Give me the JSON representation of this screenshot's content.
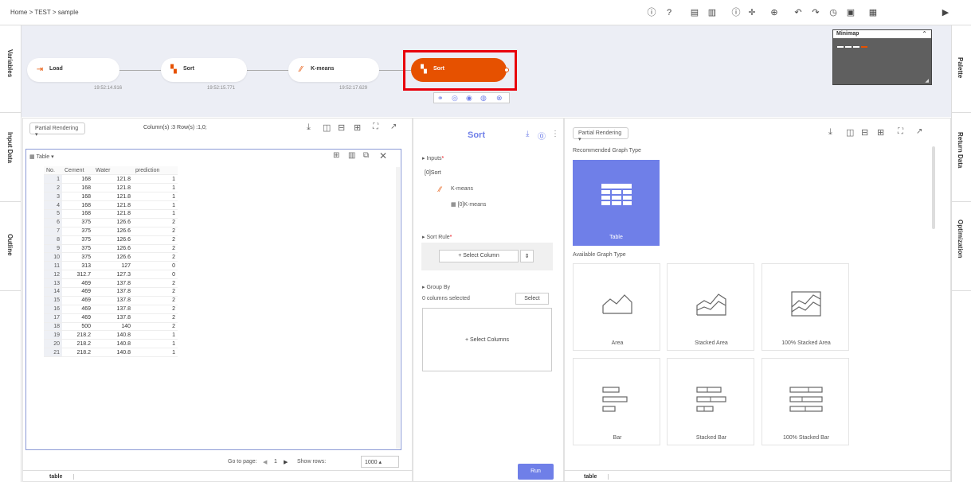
{
  "breadcrumb": "Home > TEST > sample",
  "rails": {
    "left": [
      "Variables",
      "Input Data",
      "Outline"
    ],
    "right": [
      "Palette",
      "Return Data",
      "Optimization"
    ]
  },
  "nodes": [
    {
      "label": "Load",
      "time": "19:52:14.916"
    },
    {
      "label": "Sort",
      "time": "19:52:15.771"
    },
    {
      "label": "K-means",
      "time": "19:52:17.629"
    },
    {
      "label": "Sort",
      "time": ""
    }
  ],
  "minimap": {
    "title": "Minimap"
  },
  "left_panel": {
    "render_mode": "Partial Rendering",
    "stats": "Column(s) :3   Row(s) :1,0;",
    "view_label": "Table",
    "columns": [
      "No.",
      "Cement",
      "Water",
      "prediction"
    ],
    "rows": [
      [
        "1",
        "168",
        "121.8",
        "1"
      ],
      [
        "2",
        "168",
        "121.8",
        "1"
      ],
      [
        "3",
        "168",
        "121.8",
        "1"
      ],
      [
        "4",
        "168",
        "121.8",
        "1"
      ],
      [
        "5",
        "168",
        "121.8",
        "1"
      ],
      [
        "6",
        "375",
        "126.6",
        "2"
      ],
      [
        "7",
        "375",
        "126.6",
        "2"
      ],
      [
        "8",
        "375",
        "126.6",
        "2"
      ],
      [
        "9",
        "375",
        "126.6",
        "2"
      ],
      [
        "10",
        "375",
        "126.6",
        "2"
      ],
      [
        "11",
        "313",
        "127",
        "0"
      ],
      [
        "12",
        "312.7",
        "127.3",
        "0"
      ],
      [
        "13",
        "469",
        "137.8",
        "2"
      ],
      [
        "14",
        "469",
        "137.8",
        "2"
      ],
      [
        "15",
        "469",
        "137.8",
        "2"
      ],
      [
        "16",
        "469",
        "137.8",
        "2"
      ],
      [
        "17",
        "469",
        "137.8",
        "2"
      ],
      [
        "18",
        "500",
        "140",
        "2"
      ],
      [
        "19",
        "218.2",
        "140.8",
        "1"
      ],
      [
        "20",
        "218.2",
        "140.8",
        "1"
      ],
      [
        "21",
        "218.2",
        "140.8",
        "1"
      ]
    ],
    "goto_label": "Go to page:",
    "page": "1",
    "show_rows_label": "Show rows:",
    "show_rows_value": "1000",
    "tab": "table"
  },
  "middle_panel": {
    "title": "Sort",
    "inputs_label": "Inputs",
    "input_item": "[0]Sort",
    "kmeans_label": "K-means",
    "kmeans_sub": "[0]K-means",
    "sort_rule_label": "Sort Rule",
    "select_column": "+ Select Column",
    "group_by_label": "Group By",
    "columns_selected": "0 columns selected",
    "select_btn": "Select",
    "select_columns": "+ Select Columns",
    "run": "Run"
  },
  "right_panel": {
    "render_mode": "Partial Rendering",
    "recommended_label": "Recommended Graph Type",
    "recommended": "Table",
    "available_label": "Available Graph Type",
    "graphs": [
      "Area",
      "Stacked Area",
      "100% Stacked Area",
      "Bar",
      "Stacked Bar",
      "100% Stacked Bar"
    ],
    "tab": "table"
  },
  "colors": {
    "accent": "#6f7fe8",
    "active_node": "#e65100",
    "highlight": "#e8000b",
    "canvas": "#eceef5"
  }
}
